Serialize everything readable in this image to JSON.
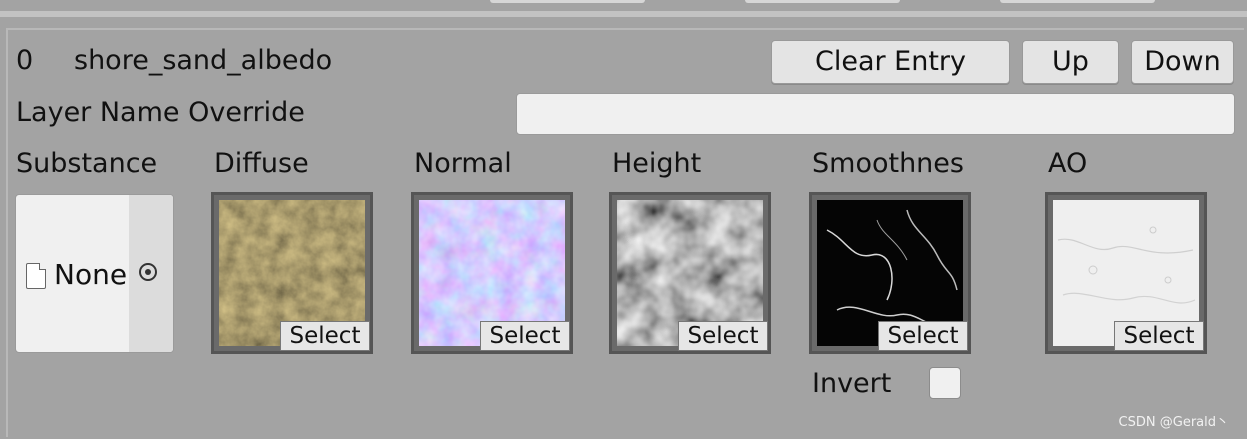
{
  "entry": {
    "index": "0",
    "name": "shore_sand_albedo",
    "buttons": {
      "clear": "Clear Entry",
      "up": "Up",
      "down": "Down"
    }
  },
  "layer_override": {
    "label": "Layer Name Override",
    "value": ""
  },
  "substance": {
    "label": "Substance",
    "value": "None"
  },
  "slots": {
    "diffuse": {
      "label": "Diffuse",
      "button": "Select",
      "color": "#5a4a2a"
    },
    "normal": {
      "label": "Normal",
      "button": "Select",
      "color": "#7a7ae0"
    },
    "height": {
      "label": "Height",
      "button": "Select",
      "color": "#6a6a6a"
    },
    "smoothness": {
      "label": "Smoothnes",
      "button": "Select",
      "color": "#0a0a0a"
    },
    "ao": {
      "label": "AO",
      "button": "Select",
      "color": "#ededed"
    }
  },
  "invert": {
    "label": "Invert",
    "checked": false
  },
  "watermark": "CSDN @Gerald丶"
}
